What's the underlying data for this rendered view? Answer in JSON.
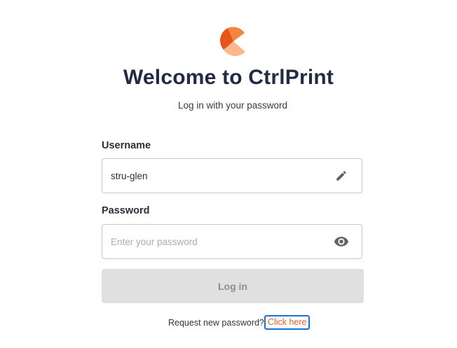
{
  "brand": {
    "logo_icon": "ctrlprint-logo-icon",
    "colors": {
      "orange_dark": "#e8531c",
      "orange_mid": "#f5843f",
      "orange_light": "#f9b98c"
    }
  },
  "header": {
    "title": "Welcome to CtrlPrint",
    "subtitle": "Log in with your password"
  },
  "form": {
    "username": {
      "label": "Username",
      "value": "stru-glen",
      "placeholder": "",
      "icon": "pencil-icon"
    },
    "password": {
      "label": "Password",
      "value": "",
      "placeholder": "Enter your password",
      "icon": "eye-icon"
    },
    "login_button": {
      "label": "Log in",
      "disabled": true
    }
  },
  "footer": {
    "request_text": "Request new password?",
    "link_text": "Click here",
    "link_color": "#e8612b",
    "focus_color": "#1a73d9"
  }
}
